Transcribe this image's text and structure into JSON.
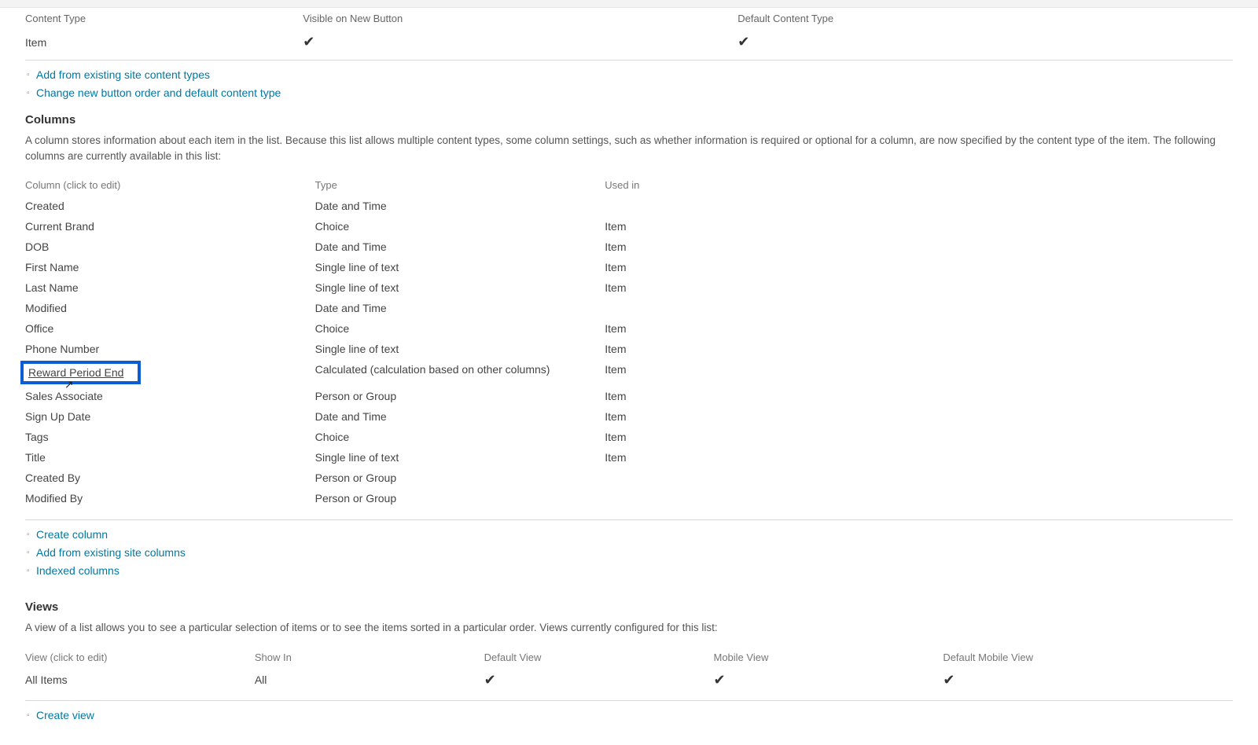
{
  "contentTypes": {
    "headers": {
      "name": "Content Type",
      "visible": "Visible on New Button",
      "default": "Default Content Type"
    },
    "rows": [
      {
        "name": "Item",
        "visible": true,
        "default": true
      }
    ],
    "links": {
      "addExisting": "Add from existing site content types",
      "changeOrder": "Change new button order and default content type"
    }
  },
  "columnsSection": {
    "title": "Columns",
    "desc": "A column stores information about each item in the list. Because this list allows multiple content types, some column settings, such as whether information is required or optional for a column, are now specified by the content type of the item. The following columns are currently available in this list:",
    "headers": {
      "col": "Column (click to edit)",
      "type": "Type",
      "used": "Used in"
    },
    "rows": [
      {
        "name": "Created",
        "type": "Date and Time",
        "used": ""
      },
      {
        "name": "Current Brand",
        "type": "Choice",
        "used": "Item"
      },
      {
        "name": "DOB",
        "type": "Date and Time",
        "used": "Item"
      },
      {
        "name": "First Name",
        "type": "Single line of text",
        "used": "Item"
      },
      {
        "name": "Last Name",
        "type": "Single line of text",
        "used": "Item"
      },
      {
        "name": "Modified",
        "type": "Date and Time",
        "used": ""
      },
      {
        "name": "Office",
        "type": "Choice",
        "used": "Item"
      },
      {
        "name": "Phone Number",
        "type": "Single line of text",
        "used": "Item"
      },
      {
        "name": "Reward Period End",
        "type": "Calculated (calculation based on other columns)",
        "used": "Item",
        "highlighted": true
      },
      {
        "name": "Sales Associate",
        "type": "Person or Group",
        "used": "Item"
      },
      {
        "name": "Sign Up Date",
        "type": "Date and Time",
        "used": "Item"
      },
      {
        "name": "Tags",
        "type": "Choice",
        "used": "Item"
      },
      {
        "name": "Title",
        "type": "Single line of text",
        "used": "Item"
      },
      {
        "name": "Created By",
        "type": "Person or Group",
        "used": ""
      },
      {
        "name": "Modified By",
        "type": "Person or Group",
        "used": ""
      }
    ],
    "links": {
      "create": "Create column",
      "addExisting": "Add from existing site columns",
      "indexed": "Indexed columns"
    }
  },
  "viewsSection": {
    "title": "Views",
    "desc": "A view of a list allows you to see a particular selection of items or to see the items sorted in a particular order. Views currently configured for this list:",
    "headers": {
      "view": "View (click to edit)",
      "showIn": "Show In",
      "default": "Default View",
      "mobile": "Mobile View",
      "defaultMobile": "Default Mobile View"
    },
    "rows": [
      {
        "name": "All Items",
        "showIn": "All",
        "default": true,
        "mobile": true,
        "defaultMobile": true
      }
    ],
    "links": {
      "create": "Create view"
    }
  }
}
